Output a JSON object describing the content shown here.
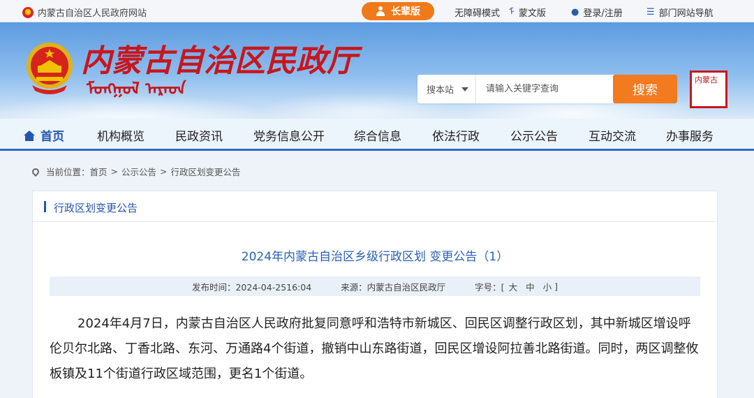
{
  "topbar": {
    "site_name": "内蒙古自治区人民政府网站",
    "elder_mode": "长辈版",
    "accessible": "无障碍模式",
    "mongolian": "蒙文版",
    "login": "登录/注册",
    "dept_nav": "部门网站导航"
  },
  "header": {
    "logo_text": "内蒙古自治区民政厅",
    "logo_mongolian": "ᠮᠣᠩᠭᠣᠯ ᠠᠷᠠᠳ",
    "search_scope": "搜本站",
    "search_placeholder": "请输入关键字查询",
    "search_button": "搜索",
    "seal_text": "内蒙古"
  },
  "nav": {
    "items": [
      "首页",
      "机构概览",
      "民政资讯",
      "党务信息公开",
      "综合信息",
      "依法行政",
      "公示公告",
      "互动交流",
      "办事服务"
    ]
  },
  "breadcrumb": {
    "prefix": "当前位置：",
    "items": [
      "首页",
      "公示公告",
      "行政区划变更公告"
    ],
    "separator": ">"
  },
  "panel": {
    "heading": "行政区划变更公告",
    "article_title": "2024年内蒙古自治区乡级行政区划 变更公告（1）",
    "meta": {
      "publish": "发布时间：2024-04-2516:04",
      "source": "来源：内蒙古自治区民政厅",
      "font_size_label": "字号：[",
      "size_large": "大",
      "size_medium": "中",
      "size_small": "小",
      "close_bracket": "]"
    },
    "body": "2024年4月7日，内蒙古自治区人民政府批复同意呼和浩特市新城区、回民区调整行政区划，其中新城区增设呼伦贝尔北路、丁香北路、东河、万通路4个街道，撤销中山东路街道，回民区增设阿拉善北路街道。同时，两区调整攸板镇及11个街道行政区域范围，更名1个街道。"
  },
  "colors": {
    "brand_red": "#c8161d",
    "nav_blue": "#2556b0",
    "accent_orange": "#f47a1f"
  }
}
